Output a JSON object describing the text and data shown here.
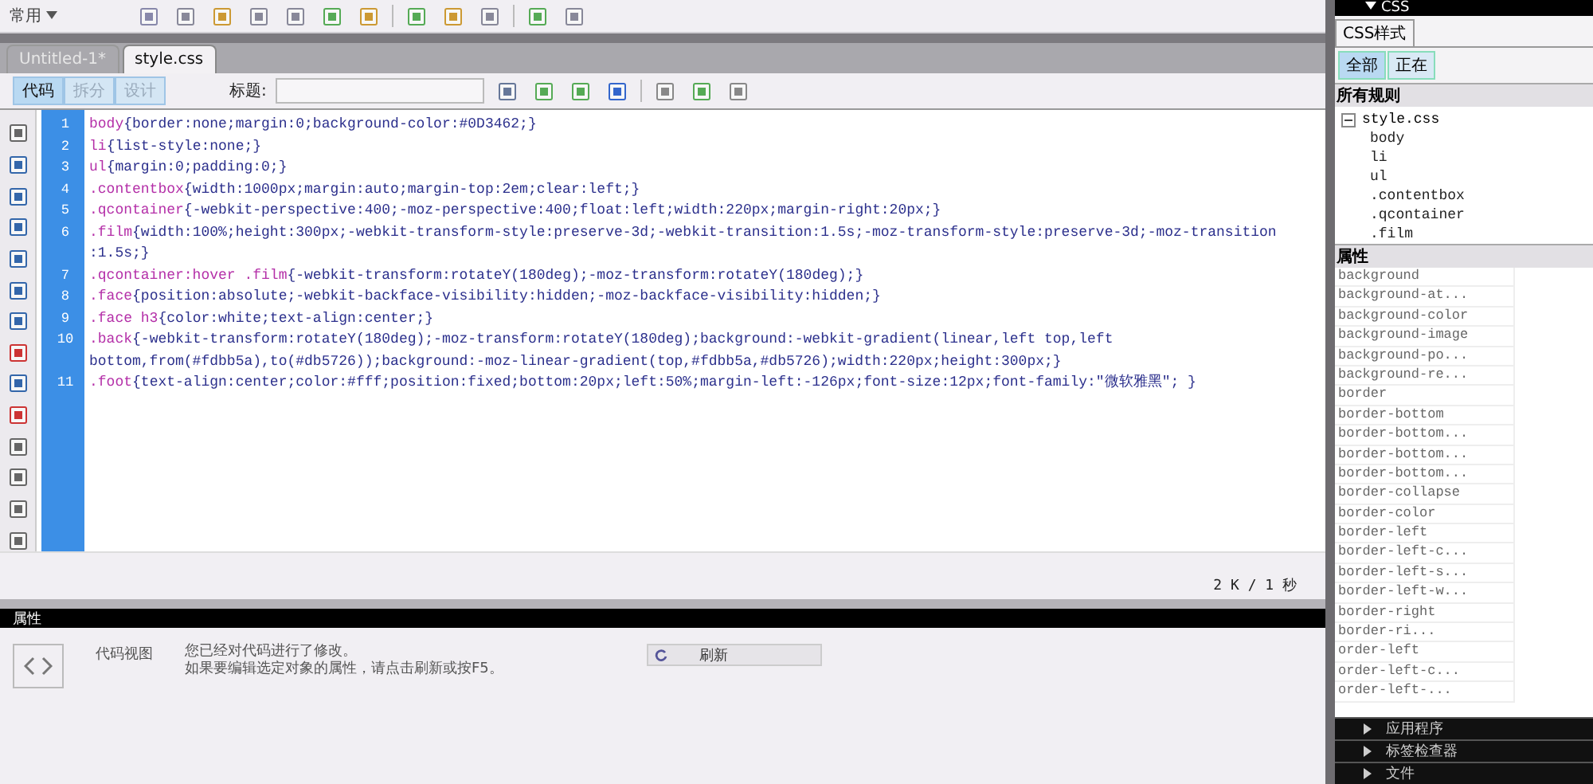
{
  "insert_bar": {
    "category": "常用"
  },
  "document_tabs": [
    {
      "label": "Untitled-1*",
      "selected": false
    },
    {
      "label": "style.css",
      "selected": true
    }
  ],
  "view_buttons": [
    {
      "label": "代码",
      "selected": true,
      "disabled": false
    },
    {
      "label": "拆分",
      "selected": false,
      "disabled": true
    },
    {
      "label": "设计",
      "selected": false,
      "disabled": true
    }
  ],
  "title_field": {
    "label": "标题:"
  },
  "code_lines": [
    {
      "number": "1",
      "text": [
        "body{border:none;margin:0;background-color:#0D3462;}"
      ]
    },
    {
      "number": "2",
      "text": [
        "li{list-style:none;}"
      ]
    },
    {
      "number": "3",
      "text": [
        "ul{margin:0;padding:0;}"
      ]
    },
    {
      "number": "4",
      "text": [
        ".contentbox{width:1000px;margin:auto;margin-top:2em;clear:left;}"
      ]
    },
    {
      "number": "5",
      "text": [
        ".qcontainer{-webkit-perspective:400;-moz-perspective:400;float:left;width:220px;margin-right:20px;}"
      ]
    },
    {
      "number": "6",
      "text": [
        ".film{width:100%;height:300px;-webkit-transform-style:preserve-3d;-webkit-transition:1.5s;-moz-transform-style:preserve-3d;-moz-transition",
        ":1.5s;}"
      ]
    },
    {
      "number": "7",
      "text": [
        ".qcontainer:hover .film{-webkit-transform:rotateY(180deg);-moz-transform:rotateY(180deg);}"
      ]
    },
    {
      "number": "8",
      "text": [
        ".face{position:absolute;-webkit-backface-visibility:hidden;-moz-backface-visibility:hidden;}"
      ]
    },
    {
      "number": "9",
      "text": [
        ".face h3{color:white;text-align:center;}"
      ]
    },
    {
      "number": "10",
      "text": [
        ".back{-webkit-transform:rotateY(180deg);-moz-transform:rotateY(180deg);background:-webkit-gradient(linear,left top,left",
        "bottom,from(#fdbb5a),to(#db5726));background:-moz-linear-gradient(top,#fdbb5a,#db5726);width:220px;height:300px;}"
      ]
    },
    {
      "number": "11",
      "text": [
        ".foot{text-align:center;color:#fff;position:fixed;bottom:20px;left:50%;margin-left:-126px;font-size:12px;font-family:\"微软雅黑\"; }"
      ]
    }
  ],
  "status": "2 K / 1 秒",
  "properties_panel": {
    "title": "属性",
    "view_label": "代码视图",
    "message": [
      "您已经对代码进行了修改。",
      "如果要编辑选定对象的属性，请点击刷新或按F5。"
    ],
    "refresh_button": "刷新"
  },
  "css_panel": {
    "title": "CSS",
    "tab": "CSS样式",
    "mode_buttons": [
      {
        "label": "全部",
        "selected": true
      },
      {
        "label": "正在",
        "selected": false
      }
    ],
    "rules_heading": "所有规则",
    "tree": {
      "label": "style.css",
      "expanded": true,
      "children": [
        {
          "label": "body"
        },
        {
          "label": "li"
        },
        {
          "label": "ul"
        },
        {
          "label": ".contentbox"
        },
        {
          "label": ".qcontainer"
        },
        {
          "label": ".film"
        }
      ]
    },
    "properties_heading": "属性",
    "properties": [
      "background",
      "background-at...",
      "background-color",
      "background-image",
      "background-po...",
      "background-re...",
      "border",
      "border-bottom",
      "border-bottom...",
      "border-bottom...",
      "border-bottom...",
      "border-collapse",
      "border-color",
      "border-left",
      "border-left-c...",
      "border-left-s...",
      "border-left-w...",
      "border-right",
      "border-ri...",
      "order-left",
      "order-left-c...",
      "order-left-..."
    ]
  },
  "collapsed_panels": [
    "应用程序",
    "标签检查器",
    "文件"
  ]
}
